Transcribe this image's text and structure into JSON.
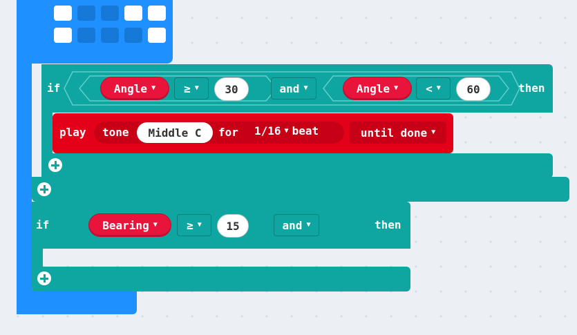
{
  "blocks": {
    "if1": {
      "if_label": "if",
      "cond_a": {
        "var": "Angle",
        "op": "≥",
        "value": "30"
      },
      "logic": "and",
      "cond_b": {
        "var": "Angle",
        "op": "<",
        "value": "60"
      },
      "then_label": "then",
      "body": {
        "play_label": "play",
        "tone_label": "tone",
        "note": "Middle C",
        "for_label": "for",
        "duration": "1/16",
        "beat_label": "beat",
        "mode": "until done"
      }
    },
    "if2": {
      "if_label": "if",
      "cond_a": {
        "var": "Bearing",
        "op": "≥",
        "value": "15"
      },
      "logic": "and",
      "then_label": "then"
    }
  },
  "led_grid": {
    "row1": [
      1,
      0,
      0,
      1,
      1
    ],
    "row2": [
      1,
      0,
      0,
      0,
      1
    ]
  },
  "colors": {
    "workspace": "#ecf0f4",
    "basic_blue": "#1e90ff",
    "logic_teal": "#0fa5a1",
    "music_red": "#e50019",
    "variable_red": "#e8143c"
  },
  "icons": {
    "dropdown": "caret-down-icon",
    "add": "plus-circle-icon"
  }
}
